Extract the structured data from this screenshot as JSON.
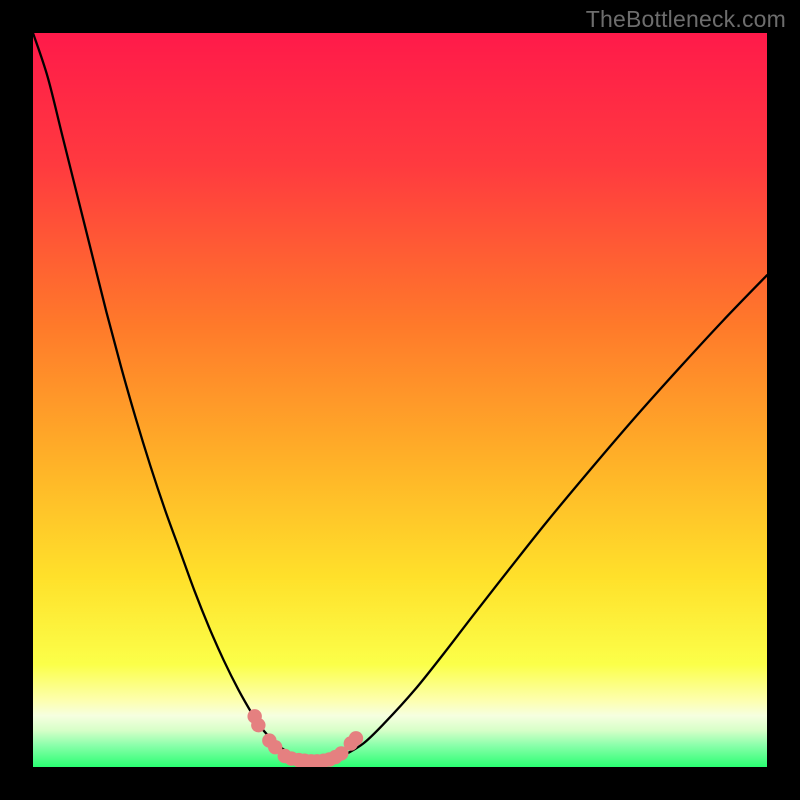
{
  "watermark": {
    "text": "TheBottleneck.com"
  },
  "colors": {
    "gradient_top": "#ff1a4a",
    "gradient_mid_orange": "#ff7a2a",
    "gradient_yellow": "#ffe02a",
    "gradient_pale_yellow": "#ffffaa",
    "gradient_green": "#2aff72",
    "curve_stroke": "#000000",
    "markers_fill": "#e58080",
    "markers_stroke": "#e58080",
    "background": "#000000"
  },
  "chart_data": {
    "type": "line",
    "title": "",
    "xlabel": "",
    "ylabel": "",
    "xlim": [
      0,
      100
    ],
    "ylim": [
      0,
      100
    ],
    "grid": false,
    "legend": false,
    "series": [
      {
        "name": "curve",
        "x": [
          0,
          2,
          4,
          6,
          8,
          10,
          12,
          14,
          16,
          18,
          20,
          22,
          24,
          26,
          28,
          30,
          31,
          32,
          33,
          34,
          35,
          36,
          37,
          38,
          39,
          40,
          41,
          42,
          45,
          48,
          52,
          56,
          60,
          65,
          70,
          76,
          82,
          88,
          94,
          100
        ],
        "y": [
          100,
          94,
          86,
          78,
          70,
          62,
          54.5,
          47.5,
          41,
          35,
          29.5,
          24,
          19,
          14.5,
          10.5,
          7,
          5.5,
          4.3,
          3.3,
          2.5,
          1.9,
          1.4,
          1.05,
          0.85,
          0.75,
          0.75,
          0.9,
          1.4,
          3.2,
          6.1,
          10.5,
          15.5,
          20.7,
          27.1,
          33.4,
          40.6,
          47.6,
          54.3,
          60.8,
          67
        ]
      }
    ],
    "markers": [
      {
        "x": 30.2,
        "y": 6.9
      },
      {
        "x": 30.7,
        "y": 5.7
      },
      {
        "x": 32.2,
        "y": 3.6
      },
      {
        "x": 33.0,
        "y": 2.7
      },
      {
        "x": 34.3,
        "y": 1.5
      },
      {
        "x": 35.2,
        "y": 1.15
      },
      {
        "x": 36.2,
        "y": 0.95
      },
      {
        "x": 37.0,
        "y": 0.85
      },
      {
        "x": 37.9,
        "y": 0.78
      },
      {
        "x": 38.7,
        "y": 0.78
      },
      {
        "x": 39.6,
        "y": 0.85
      },
      {
        "x": 40.4,
        "y": 1.02
      },
      {
        "x": 41.2,
        "y": 1.35
      },
      {
        "x": 42.0,
        "y": 1.85
      },
      {
        "x": 43.3,
        "y": 3.2
      },
      {
        "x": 44.0,
        "y": 3.9
      }
    ]
  }
}
